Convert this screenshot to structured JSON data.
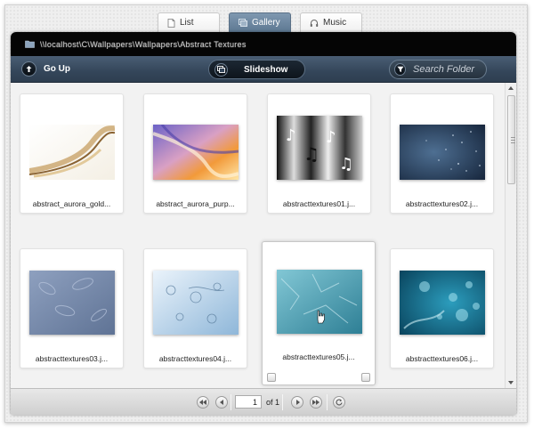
{
  "tabs": [
    {
      "label": "List",
      "icon": "document-icon",
      "active": false
    },
    {
      "label": "Gallery",
      "icon": "gallery-icon",
      "active": true
    },
    {
      "label": "Music",
      "icon": "headphones-icon",
      "active": false
    }
  ],
  "pathbar": {
    "path": "\\\\localhost\\C\\Wallpapers\\Wallpapers\\Abstract Textures"
  },
  "toolbar": {
    "go_up": "Go Up",
    "slideshow": "Slideshow",
    "search_placeholder": "Search Folder"
  },
  "gallery": {
    "items": [
      {
        "name": "abstract_aurora_gold..."
      },
      {
        "name": "abstract_aurora_purp..."
      },
      {
        "name": "abstracttextures01.j..."
      },
      {
        "name": "abstracttextures02.j..."
      },
      {
        "name": "abstracttextures03.j..."
      },
      {
        "name": "abstracttextures04.j..."
      },
      {
        "name": "abstracttextures05.j..."
      },
      {
        "name": "abstracttextures06.j..."
      }
    ]
  },
  "pager": {
    "current_page": "1",
    "of_label": "of",
    "total_pages": "1"
  },
  "colors": {
    "toolbar": "#3a4c60",
    "active_tab": "#6f88a1",
    "pathbar": "#050505"
  }
}
